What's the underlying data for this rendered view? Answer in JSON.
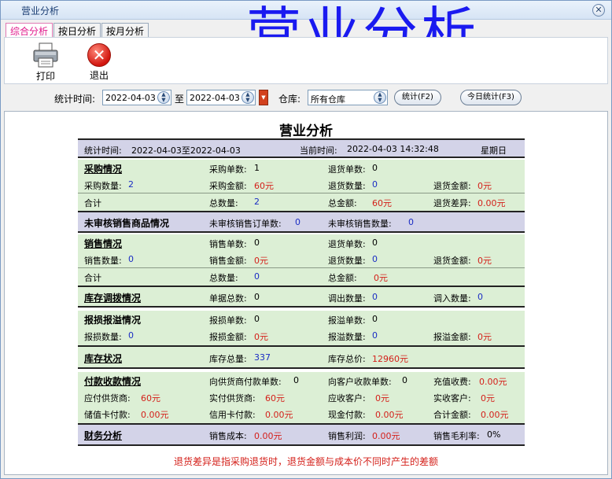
{
  "window": {
    "title": "营业分析",
    "watermark": "营业分析",
    "close_glyph": "✕"
  },
  "tabs": [
    {
      "label": "综合分析"
    },
    {
      "label": "按日分析"
    },
    {
      "label": "按月分析"
    }
  ],
  "toolbar": {
    "print_label": "打印",
    "exit_label": "退出"
  },
  "filter": {
    "time_label": "统计时间:",
    "date_from": "2022-04-03",
    "to_label": "至",
    "date_to": "2022-04-03",
    "warehouse_label": "仓库:",
    "warehouse_value": "所有仓库",
    "stat_button": "统计(F2)",
    "today_button": "今日统计(F3)"
  },
  "report": {
    "title": "营业分析",
    "header": {
      "time_label": "统计时间:",
      "time_value": "2022-04-03至2022-04-03",
      "now_label": "当前时间:",
      "now_value": "2022-04-03 14:32:48",
      "weekday": "星期日"
    },
    "purchase": {
      "title": "采购情况",
      "orders_label": "采购单数:",
      "orders_value": "1",
      "return_orders_label": "退货单数:",
      "return_orders_value": "0",
      "qty_label": "采购数量:",
      "qty_value": "2",
      "amount_label": "采购金额:",
      "amount_value": "60元",
      "return_qty_label": "退货数量:",
      "return_qty_value": "0",
      "return_amount_label": "退货金额:",
      "return_amount_value": "0元",
      "total_label": "合计",
      "total_qty_label": "总数量:",
      "total_qty_value": "2",
      "total_amount_label": "总金额:",
      "total_amount_value": "60元",
      "return_diff_label": "退货差异:",
      "return_diff_value": "0.00元"
    },
    "unaudited": {
      "title": "未审核销售商品情况",
      "orders_label": "未审核销售订单数:",
      "orders_value": "0",
      "qty_label": "未审核销售数量:",
      "qty_value": "0"
    },
    "sales": {
      "title": "销售情况",
      "orders_label": "销售单数:",
      "orders_value": "0",
      "return_orders_label": "退货单数:",
      "return_orders_value": "0",
      "qty_label": "销售数量:",
      "qty_value": "0",
      "amount_label": "销售金额:",
      "amount_value": "0元",
      "return_qty_label": "退货数量:",
      "return_qty_value": "0",
      "return_amount_label": "退货金额:",
      "return_amount_value": "0元",
      "total_label": "合计",
      "total_qty_label": "总数量:",
      "total_qty_value": "0",
      "total_amount_label": "总金额:",
      "total_amount_value": "0元"
    },
    "transfer": {
      "title": "库存调拨情况",
      "docs_label": "单据总数:",
      "docs_value": "0",
      "out_label": "调出数量:",
      "out_value": "0",
      "in_label": "调入数量:",
      "in_value": "0"
    },
    "loss": {
      "title": "报损报溢情况",
      "loss_orders_label": "报损单数:",
      "loss_orders_value": "0",
      "gain_orders_label": "报溢单数:",
      "gain_orders_value": "0",
      "loss_qty_label": "报损数量:",
      "loss_qty_value": "0",
      "loss_amount_label": "报损金额:",
      "loss_amount_value": "0元",
      "gain_qty_label": "报溢数量:",
      "gain_qty_value": "0",
      "gain_amount_label": "报溢金额:",
      "gain_amount_value": "0元"
    },
    "stock": {
      "title": "库存状况",
      "total_label": "库存总量:",
      "total_value": "337",
      "price_label": "库存总价:",
      "price_value": "12960元"
    },
    "payment": {
      "title": "付款收款情况",
      "supplier_orders_label": "向供货商付款单数:",
      "supplier_orders_value": "0",
      "customer_orders_label": "向客户收款单数:",
      "customer_orders_value": "0",
      "recharge_label": "充值收费:",
      "recharge_value": "0.00元",
      "payable_label": "应付供货商:",
      "payable_value": "60元",
      "paid_label": "实付供货商:",
      "paid_value": "60元",
      "receivable_label": "应收客户:",
      "receivable_value": "0元",
      "received_label": "实收客户:",
      "received_value": "0元",
      "card_pay_label": "储值卡付款:",
      "card_pay_value": "0.00元",
      "credit_pay_label": "信用卡付款:",
      "credit_pay_value": "0.00元",
      "cash_pay_label": "现金付款:",
      "cash_pay_value": "0.00元",
      "total_amount_label": "合计金额:",
      "total_amount_value": "0.00元"
    },
    "finance": {
      "title": "财务分析",
      "cost_label": "销售成本:",
      "cost_value": "0.00元",
      "profit_label": "销售利润:",
      "profit_value": "0.00元",
      "margin_label": "销售毛利率:",
      "margin_value": "0%"
    },
    "footnote": "退货差异是指采购退货时，退货金额与成本价不同时产生的差额"
  },
  "colors": {
    "accent_blue": "#1a2cc4",
    "accent_red": "#d4201a",
    "section_green": "#dcefd5",
    "section_blue": "#d3d3e8"
  },
  "icons": {
    "print": "printer-icon",
    "exit": "exit-icon",
    "spin": "spin-icon"
  }
}
